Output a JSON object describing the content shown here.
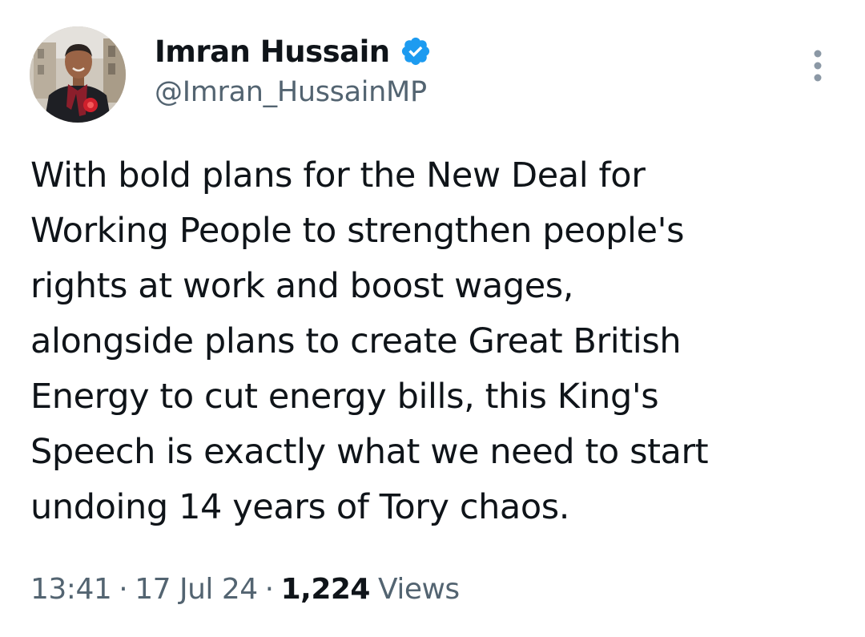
{
  "author": {
    "display_name": "Imran Hussain",
    "handle": "@Imran_HussainMP",
    "verified": true,
    "verified_color": "#1d9bf0",
    "avatar": "profile-photo"
  },
  "tweet": {
    "lines": [
      "With bold plans for the New Deal for",
      "Working People to strengthen people's",
      "rights at work and boost wages,",
      "alongside plans to create Great British",
      "Energy to cut energy bills, this King's",
      "Speech is exactly what we need to start",
      "undoing 14 years of Tory chaos."
    ]
  },
  "meta": {
    "time": "13:41",
    "separator": "·",
    "date": "17 Jul 24",
    "views_count": "1,224",
    "views_label": "Views"
  },
  "icons": {
    "more": "more-vertical-icon",
    "verified": "verified-badge-icon"
  },
  "colors": {
    "text_primary": "#0f1419",
    "text_secondary": "#536471",
    "badge": "#1d9bf0"
  }
}
